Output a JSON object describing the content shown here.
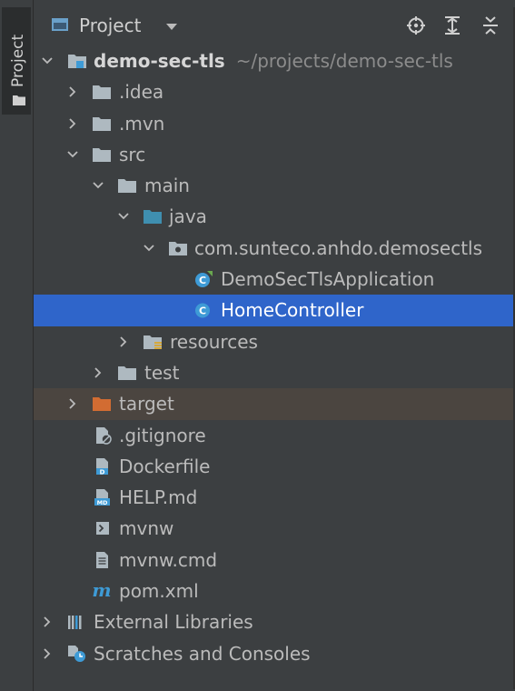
{
  "sidebar": {
    "tab_label": "Project"
  },
  "header": {
    "title": "Project"
  },
  "tree": {
    "root": {
      "label": "demo-sec-tls",
      "path": "~/projects/demo-sec-tls"
    },
    "idea": ".idea",
    "mvn": ".mvn",
    "src": "src",
    "main": "main",
    "java": "java",
    "package": "com.sunteco.anhdo.demosectls",
    "app_class": "DemoSecTlsApplication",
    "home_class": "HomeController",
    "resources": "resources",
    "test": "test",
    "target": "target",
    "gitignore": ".gitignore",
    "dockerfile": "Dockerfile",
    "help": "HELP.md",
    "mvnw": "mvnw",
    "mvnw_cmd": "mvnw.cmd",
    "pom": "pom.xml",
    "external_libs": "External Libraries",
    "scratches": "Scratches and Consoles"
  },
  "colors": {
    "background": "#3c3f41",
    "selection": "#2f65ca",
    "excluded_row": "#4b4540",
    "folder": "#aeb9c0",
    "source_folder": "#3f8fb0",
    "excluded_folder": "#d26c32",
    "class_icon": "#3e9bd6"
  }
}
